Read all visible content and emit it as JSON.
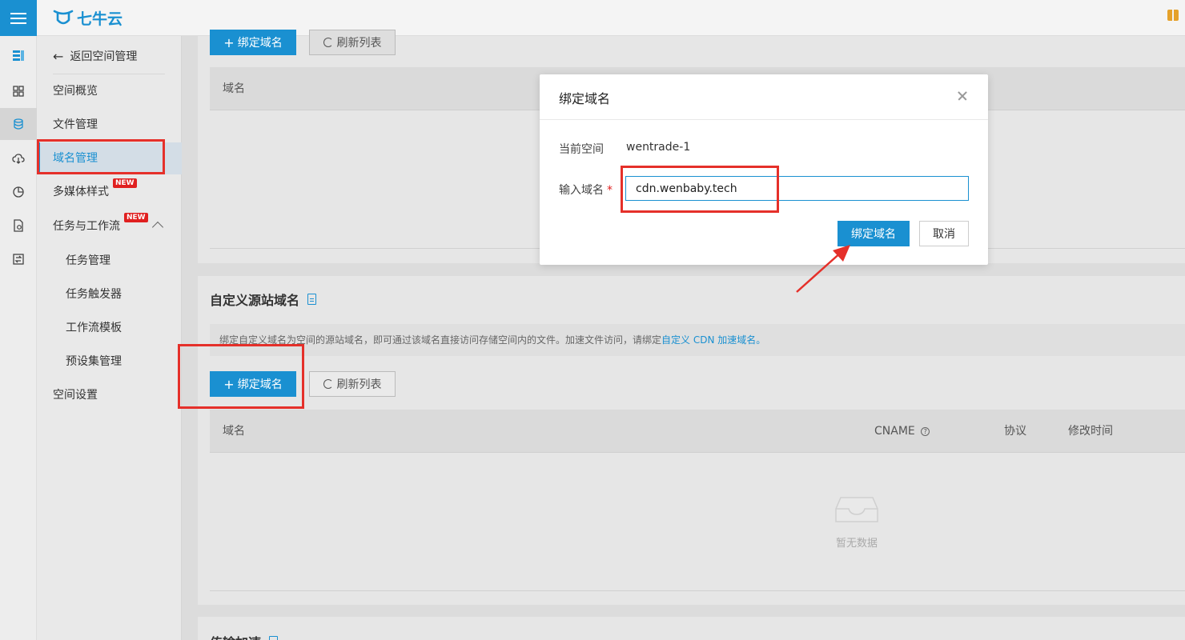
{
  "header": {
    "logo_text": "七牛云",
    "icons": [
      "menu-icon",
      "qiniu-logo-icon",
      "gift-icon"
    ]
  },
  "rail": {
    "icons": [
      "app-grid-icon",
      "dashboard-icon",
      "storage-icon",
      "cloud-icon",
      "pie-chart-icon",
      "file-search-icon",
      "transcode-icon"
    ]
  },
  "nav": {
    "back_label": "返回空间管理",
    "items": [
      {
        "label": "空间概览"
      },
      {
        "label": "文件管理"
      },
      {
        "label": "域名管理"
      },
      {
        "label": "多媒体样式",
        "badge": "NEW"
      },
      {
        "label": "任务与工作流",
        "badge": "NEW"
      },
      {
        "label": "任务管理"
      },
      {
        "label": "任务触发器"
      },
      {
        "label": "工作流模板"
      },
      {
        "label": "预设集管理"
      },
      {
        "label": "空间设置"
      }
    ]
  },
  "top_section": {
    "bind_button": "绑定域名",
    "refresh_button": "刷新列表",
    "column_domain": "域名"
  },
  "origin_section": {
    "title": "自定义源站域名",
    "tip_text": "绑定自定义域名为空间的源站域名，即可通过该域名直接访问存储空间内的文件。加速文件访问，请绑定",
    "tip_link": "自定义 CDN 加速域名。",
    "bind_button": "绑定域名",
    "refresh_button": "刷新列表",
    "columns": {
      "domain": "域名",
      "cname": "CNAME",
      "protocol": "协议",
      "modified": "修改时间"
    },
    "empty_text": "暂无数据"
  },
  "next_section": {
    "title": "传输加速"
  },
  "modal": {
    "title": "绑定域名",
    "current_space_label": "当前空间",
    "current_space_value": "wentrade-1",
    "domain_label": "输入域名",
    "domain_required": "*",
    "domain_value": "cdn.wenbaby.tech",
    "confirm_button": "绑定域名",
    "cancel_button": "取消"
  },
  "colors": {
    "accent": "#1a90d1",
    "annotation": "#e5302a",
    "badge": "#e02020"
  }
}
